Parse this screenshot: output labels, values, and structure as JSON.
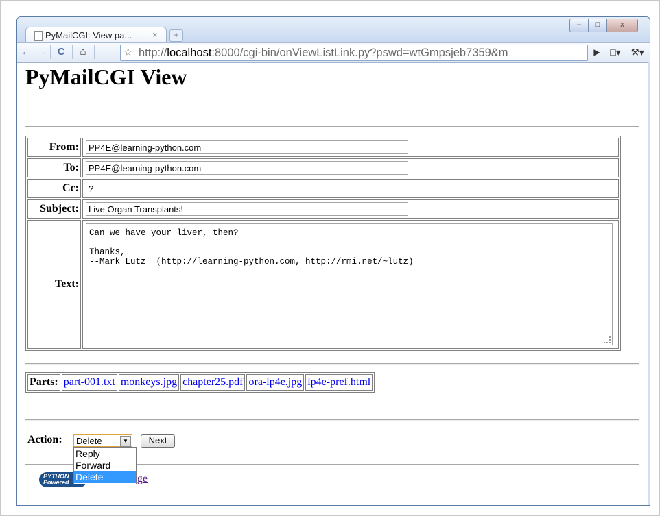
{
  "browser": {
    "tab_title": "PyMailCGI: View pa...",
    "tab_close": "×",
    "new_tab": "+",
    "url_scheme": "http://",
    "url_host": "localhost",
    "url_rest": ":8000/cgi-bin/onViewListLink.py?pswd=wtGmpsjeb7359&m",
    "window_buttons": {
      "minimize": "–",
      "maximize": "□",
      "close": "x"
    },
    "toolbar_icons": [
      "back-icon",
      "forward-icon",
      "reload-icon",
      "home-icon",
      "star-icon",
      "go-icon",
      "page-menu-icon",
      "wrench-icon"
    ]
  },
  "page": {
    "title": "PyMailCGI View",
    "headers": [
      {
        "label": "From:",
        "value": "PP4E@learning-python.com"
      },
      {
        "label": "To:",
        "value": "PP4E@learning-python.com"
      },
      {
        "label": "Cc:",
        "value": "?"
      },
      {
        "label": "Subject:",
        "value": "Live Organ Transplants!"
      }
    ],
    "text_label": "Text:",
    "text_body": "Can we have your liver, then?\n\nThanks,\n--Mark Lutz  (http://learning-python.com, http://rmi.net/~lutz)",
    "parts_label": "Parts:",
    "parts": [
      "part-001.txt",
      "monkeys.jpg",
      "chapter25.pdf",
      "ora-lp4e.jpg",
      "lp4e-pref.html"
    ],
    "action_label": "Action:",
    "action_selected": "Delete",
    "action_options": [
      "Reply",
      "Forward",
      "Delete"
    ],
    "next_button": "Next",
    "logo_text_1": "PYTHON",
    "logo_text_2": "Powered",
    "back_link": "Back to root page",
    "back_link_visible": "o root page"
  },
  "colors": {
    "link": "#0000ee",
    "visited_link": "#551a8b",
    "select_highlight": "#3399ff",
    "select_focus_border": "#e1a340"
  }
}
